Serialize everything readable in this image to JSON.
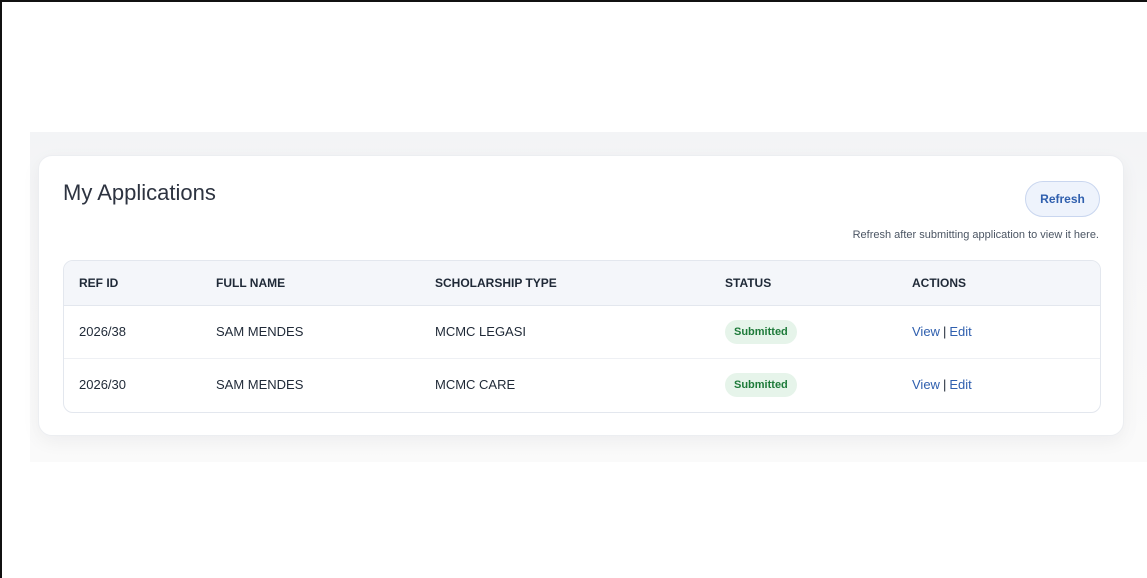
{
  "colors": {
    "accent": "#2f5fae",
    "badge_bg": "#e6f4ea",
    "badge_text": "#1e7b3a",
    "header_bg": "#f4f6fa"
  },
  "panel": {
    "title": "My Applications",
    "refresh_label": "Refresh",
    "hint": "Refresh after submitting application to view it here."
  },
  "table": {
    "headers": [
      "REF ID",
      "FULL NAME",
      "SCHOLARSHIP TYPE",
      "STATUS",
      "ACTIONS"
    ],
    "rows": [
      {
        "ref_id": "2026/38",
        "full_name": "SAM MENDES",
        "scholarship_type": "MCMC LEGASI",
        "status": "Submitted",
        "view": "View",
        "separator": "|",
        "edit": "Edit"
      },
      {
        "ref_id": "2026/30",
        "full_name": "SAM MENDES",
        "scholarship_type": "MCMC CARE",
        "status": "Submitted",
        "view": "View",
        "separator": "|",
        "edit": "Edit"
      }
    ]
  }
}
